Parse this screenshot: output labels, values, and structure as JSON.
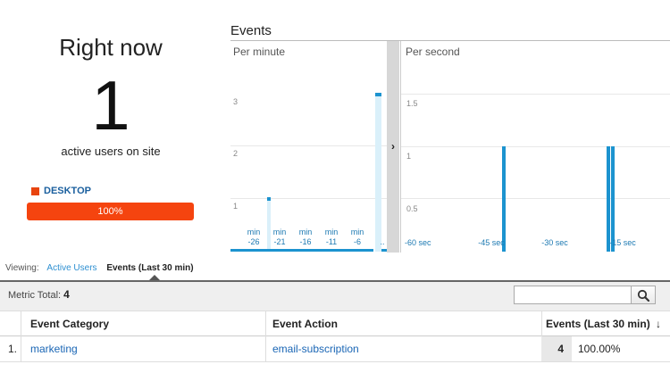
{
  "right_now": {
    "title": "Right now",
    "active_count": "1",
    "subtitle": "active users on site",
    "device_label": "DESKTOP",
    "device_percent_label": "100%",
    "device_percent": 100,
    "device_color": "#f5440f"
  },
  "events": {
    "title": "Events",
    "per_minute": {
      "label": "Per minute",
      "y_ticks": [
        "3",
        "2",
        "1"
      ],
      "x_ticks": [
        {
          "top": "min",
          "bottom": "-26"
        },
        {
          "top": "min",
          "bottom": "-21"
        },
        {
          "top": "min",
          "bottom": "-16"
        },
        {
          "top": "min",
          "bottom": "-11"
        },
        {
          "top": "min",
          "bottom": "-6"
        }
      ],
      "overflow_mark": ".."
    },
    "per_second": {
      "label": "Per second",
      "y_ticks": [
        "1.5",
        "1",
        "0.5"
      ],
      "x_ticks": [
        "-60 sec",
        "-45 sec",
        "-30 sec",
        "-15 sec"
      ]
    },
    "expand_arrow": "›"
  },
  "viewing": {
    "label": "Viewing:",
    "link": "Active Users",
    "current": "Events (Last 30 min)"
  },
  "metric": {
    "label": "Metric Total:",
    "value": "4"
  },
  "search": {
    "placeholder": ""
  },
  "table": {
    "headers": [
      "Event Category",
      "Event Action",
      "Events (Last 30 min)"
    ],
    "sort_icon": "↓",
    "rows": [
      {
        "index": "1.",
        "category": "marketing",
        "action": "email-subscription",
        "events": "4",
        "percent": "100.00%"
      }
    ]
  },
  "colors": {
    "accent": "#1c93cf",
    "link": "#1a66b5",
    "device_bar": "#f5440f"
  }
}
